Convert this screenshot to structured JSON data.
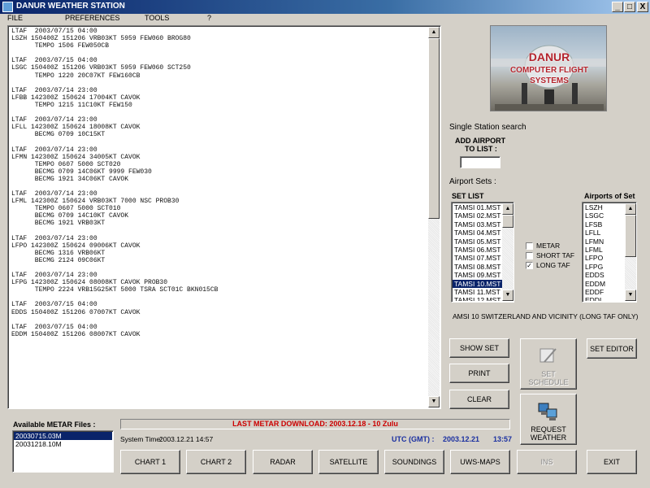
{
  "window": {
    "title": "DANUR WEATHER STATION",
    "minimize": "_",
    "maximize": "□",
    "close": "X"
  },
  "menu": [
    "FILE",
    "PREFERENCES",
    "TOOLS",
    "?"
  ],
  "taf_text": "LTAF  2003/07/15 04:00\nLSZH 150400Z 151206 VRB03KT 5959 FEW060 BROG80\n      TEMPO 1506 FEW050CB\n\nLTAF  2003/07/15 04:00\nLSGC 150400Z 151206 VRB03KT 5959 FEW060 SCT250\n      TEMPO 1220 20C07KT FEW160CB\n\nLTAF  2003/07/14 23:00\nLFBB 142300Z 150624 17004KT CAVOK\n      TEMPO 1215 11C10KT FEW150\n\nLTAF  2003/07/14 23:00\nLFLL 142300Z 150624 18008KT CAVOK\n      BECMG 0709 10C15KT\n\nLTAF  2003/07/14 23:00\nLFMN 142300Z 150624 34005KT CAVOK\n      TEMPO 0607 5000 SCT020\n      BECMG 0709 14C06KT 9999 FEW030\n      BECMG 1921 34C06KT CAVOK\n\nLTAF  2003/07/14 23:00\nLFML 142300Z 150624 VRB03KT 7000 NSC PROB30\n      TEMPO 0607 5000 SCT010\n      BECMG 0709 14C10KT CAVOK\n      BECMG 1921 VRB03KT\n\nLTAF  2003/07/14 23:00\nLFPO 142300Z 150624 09006KT CAVOK\n      BECMG 1316 VRB06KT\n      BECMG 2124 09C06KT\n\nLTAF  2003/07/14 23:00\nLFPG 142300Z 150624 08008KT CAVOK PROB30\n      TEMPO 2224 VRB15G25KT 5000 TSRA SCT01C BKN015CB\n\nLTAF  2003/07/15 04:00\nEDDS 150400Z 151206 07007KT CAVOK\n\nLTAF  2003/07/15 04:00\nEDDM 150400Z 151206 08007KT CAVOK",
  "logo": {
    "line1": "DANUR",
    "line2": "COMPUTER FLIGHT",
    "line3": "SYSTEMS"
  },
  "single_station": {
    "heading": "Single Station search",
    "add_label_line1": "ADD AIRPORT",
    "add_label_line2": "TO LIST :",
    "input_value": ""
  },
  "airport_sets": {
    "heading": "Airport Sets :",
    "set_list_label": "SET LIST",
    "sets": [
      "TAMSI 01.MST",
      "TAMSI 02.MST",
      "TAMSI 03.MST",
      "TAMSI 04.MST",
      "TAMSI 05.MST",
      "TAMSI 06.MST",
      "TAMSI 07.MST",
      "TAMSI 08.MST",
      "TAMSI 09.MST",
      "TAMSI 10.MST",
      "TAMSI 11.MST",
      "TAMSI 12.MST"
    ],
    "selected_set_index": 9,
    "airports_label": "Airports of Set",
    "airports": [
      "LSZH",
      "LSGC",
      "LFSB",
      "LFLL",
      "LFMN",
      "LFML",
      "LFPO",
      "LFPG",
      "EDDS",
      "EDDM",
      "EDDF",
      "EDDL"
    ],
    "options": [
      {
        "label": "METAR",
        "checked": false
      },
      {
        "label": "SHORT TAF",
        "checked": false
      },
      {
        "label": "LONG TAF",
        "checked": true
      }
    ],
    "description": "AMSI 10 SWITZERLAND AND VICINITY (LONG TAF ONLY)"
  },
  "buttons": {
    "show_set": "SHOW SET",
    "print": "PRINT",
    "clear": "CLEAR",
    "set_schedule_line1": "SET",
    "set_schedule_line2": "SCHEDULE",
    "set_editor": "SET EDITOR",
    "request_line1": "REQUEST",
    "request_line2": "WEATHER"
  },
  "metar_files": {
    "label": "Available METAR Files :",
    "files": [
      "20030715.03M",
      "20031218.10M"
    ],
    "selected_index": 0
  },
  "status": {
    "last_download": "LAST METAR DOWNLOAD: 2003.12.18 - 10 Zulu",
    "system_time_label": "System Time:",
    "system_time_value": "2003.12.21    14:57",
    "utc_label": "UTC (GMT) :",
    "utc_date": "2003.12.21",
    "utc_time": "13:57"
  },
  "bottom_buttons": [
    "CHART 1",
    "CHART 2",
    "RADAR",
    "SATELLITE",
    "SOUNDINGS",
    "UWS-MAPS",
    "INS",
    "EXIT"
  ],
  "colors": {
    "title_gradient_start": "#0a246a",
    "status_red": "#cc0000",
    "utc_blue": "#1a2fa0",
    "selection": "#0a246a"
  }
}
